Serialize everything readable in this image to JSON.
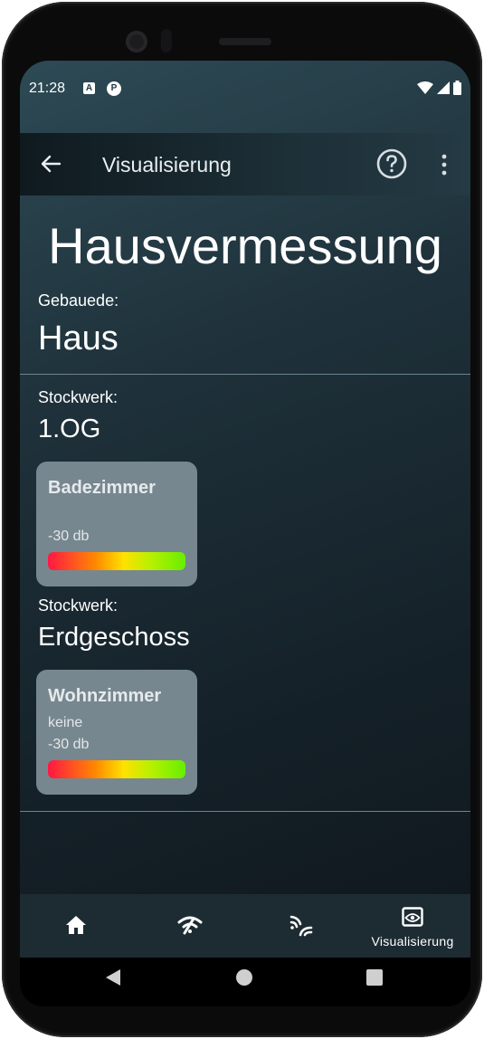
{
  "status_bar": {
    "time": "21:28",
    "notif_1": "A",
    "notif_2": "P"
  },
  "app_bar": {
    "title": "Visualisierung"
  },
  "page": {
    "heading": "Hausvermessung",
    "building_label": "Gebauede:",
    "building_value": "Haus"
  },
  "floors": [
    {
      "label": "Stockwerk:",
      "name": "1.OG",
      "room": {
        "name": "Badezimmer",
        "info": "",
        "signal": "-30 db",
        "signal_level": 1.0
      }
    },
    {
      "label": "Stockwerk:",
      "name": "Erdgeschoss",
      "room": {
        "name": "Wohnzimmer",
        "info": "keine",
        "signal": "-30 db",
        "signal_level": 1.0
      }
    }
  ],
  "bottom_nav": {
    "items": [
      {
        "icon": "home-icon",
        "label": ""
      },
      {
        "icon": "wifi-scan-icon",
        "label": ""
      },
      {
        "icon": "signal-waves-icon",
        "label": ""
      },
      {
        "icon": "eye-icon",
        "label": "Visualisierung",
        "active": true
      }
    ]
  },
  "colors": {
    "background_top": "#2d4a55",
    "background_bottom": "#0f161b",
    "card": "#77878f",
    "bar_gradient": [
      "#ff1744",
      "#ff8a00",
      "#ffe100",
      "#66ee00"
    ]
  }
}
